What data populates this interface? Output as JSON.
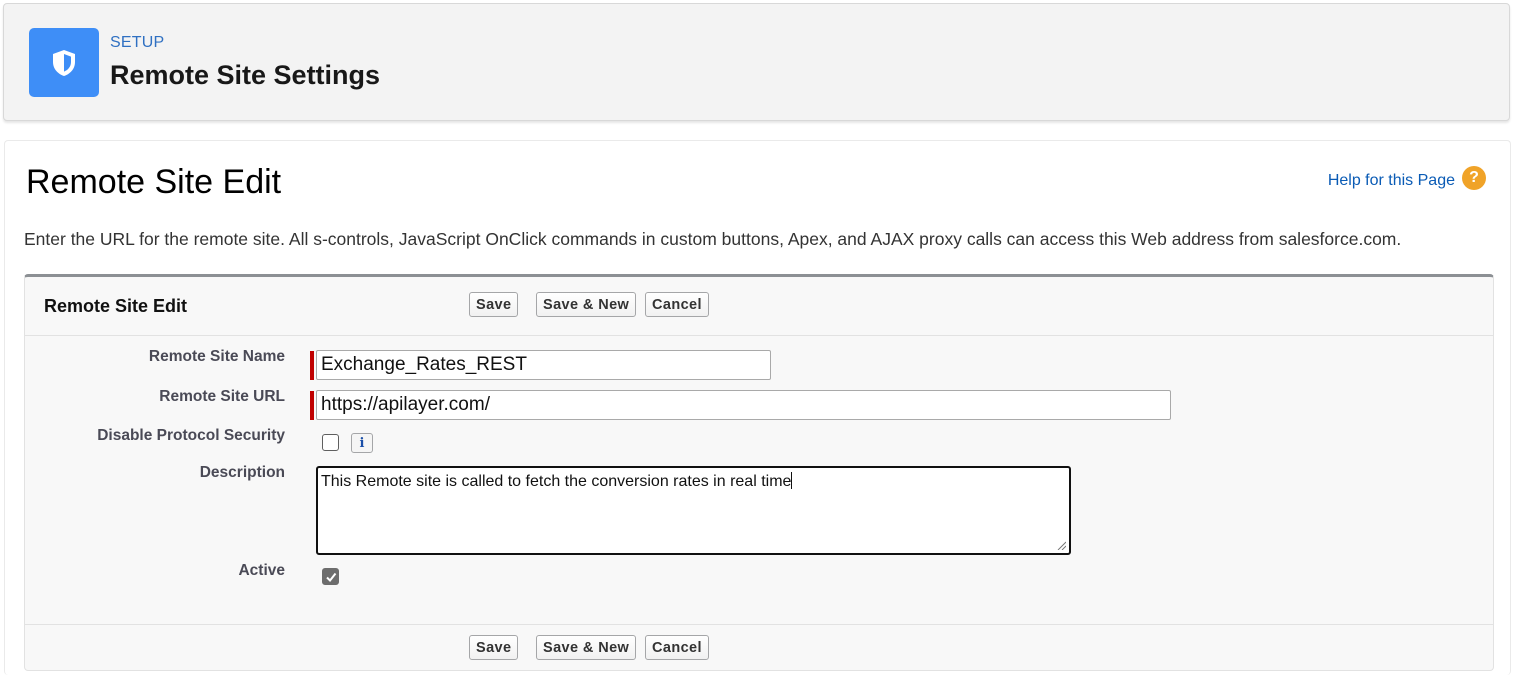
{
  "setup_header": {
    "label": "SETUP",
    "title": "Remote Site Settings",
    "icon": "shield-icon"
  },
  "page": {
    "title": "Remote Site Edit",
    "help_link": "Help for this Page",
    "help_icon": "?",
    "intro": "Enter the URL for the remote site. All s-controls, JavaScript OnClick commands in custom buttons, Apex, and AJAX proxy calls can access this Web address from salesforce.com."
  },
  "panel": {
    "title": "Remote Site Edit",
    "buttons": {
      "save": "Save",
      "save_new": "Save & New",
      "cancel": "Cancel"
    }
  },
  "form": {
    "remote_site_name": {
      "label": "Remote Site Name",
      "value": "Exchange_Rates_REST",
      "required": true
    },
    "remote_site_url": {
      "label": "Remote Site URL",
      "value": "https://apilayer.com/",
      "required": true
    },
    "disable_protocol_security": {
      "label": "Disable Protocol Security",
      "checked": false,
      "info_icon": "i"
    },
    "description": {
      "label": "Description",
      "value": "This Remote site is called to fetch the conversion rates in real time"
    },
    "active": {
      "label": "Active",
      "checked": true
    }
  },
  "colors": {
    "setup_icon_bg": "#3e8ef7",
    "link": "#0a5bb5",
    "help_icon_bg": "#f0a328",
    "required_bar": "#c00000"
  }
}
